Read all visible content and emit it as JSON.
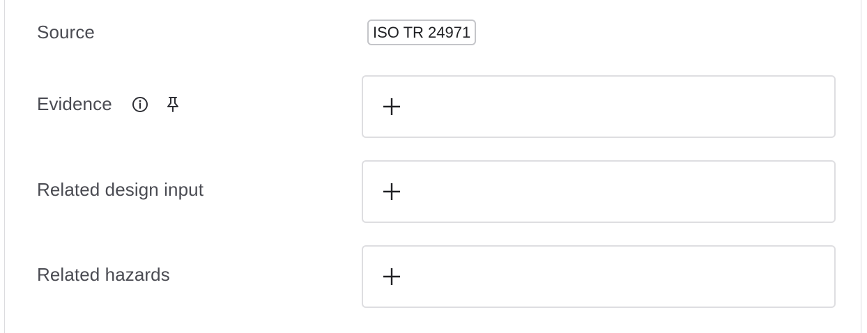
{
  "fields": {
    "source": {
      "label": "Source",
      "tag": "ISO TR 24971"
    },
    "evidence": {
      "label": "Evidence",
      "icons": [
        "info-icon",
        "pin-icon"
      ],
      "add_icon": "plus-icon"
    },
    "related_design_input": {
      "label": "Related design input",
      "add_icon": "plus-icon"
    },
    "related_hazards": {
      "label": "Related hazards",
      "add_icon": "plus-icon"
    }
  },
  "colors": {
    "label_text": "#4a4b52",
    "field_border": "#dedee1",
    "tag_border": "#c4c5c9",
    "icon": "#2e2f35"
  }
}
